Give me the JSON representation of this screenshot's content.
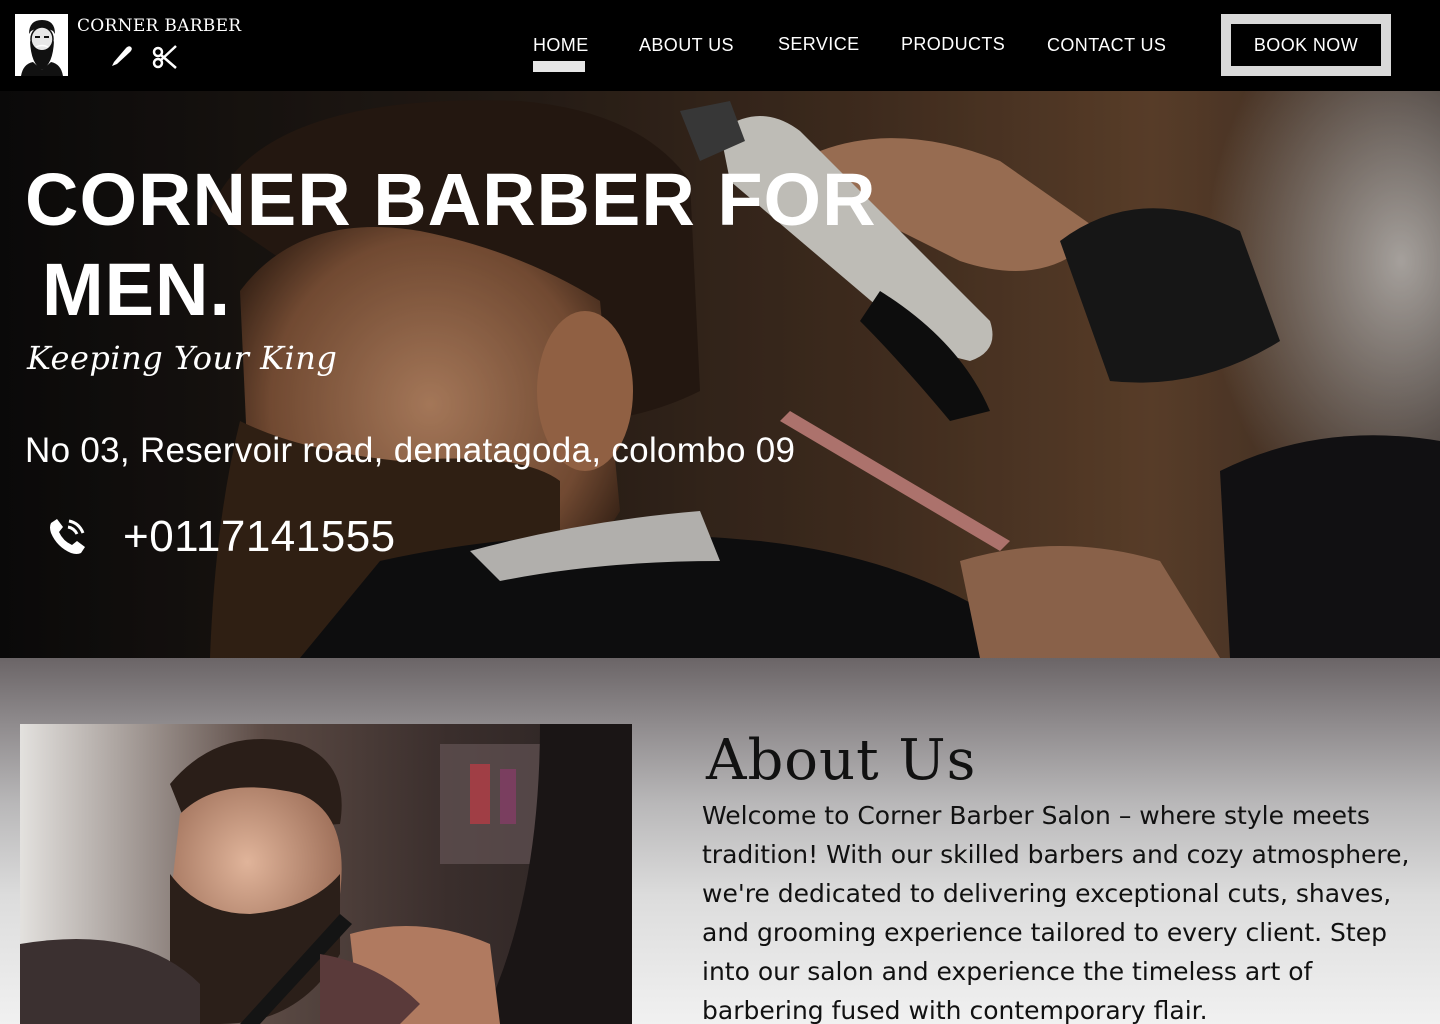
{
  "header": {
    "brand": "CORNER BARBER",
    "nav": [
      {
        "label": "HOME",
        "active": true
      },
      {
        "label": "ABOUT US"
      },
      {
        "label": "SERVICE"
      },
      {
        "label": "PRODUCTS"
      },
      {
        "label": "CONTACT US"
      }
    ],
    "book_now": "BOOK NOW"
  },
  "hero": {
    "title_line1": "CORNER BARBER FOR",
    "title_line2": "MEN.",
    "tagline": "Keeping Your King",
    "address": "No 03, Reservoir road, dematagoda, colombo 09",
    "phone": "+0117141555",
    "phone_icon": "phone-icon"
  },
  "about": {
    "heading": "About Us",
    "text": "Welcome to Corner Barber Salon – where style meets tradition! With our skilled barbers and cozy atmosphere, we're dedicated to delivering exceptional cuts, shaves, and grooming experience tailored to every client. Step into our salon and experience the timeless art of barbering fused with contemporary flair."
  },
  "colors": {
    "nav_bg": "#000000",
    "text_light": "#ffffff",
    "button_border": "#d9d9d9"
  }
}
